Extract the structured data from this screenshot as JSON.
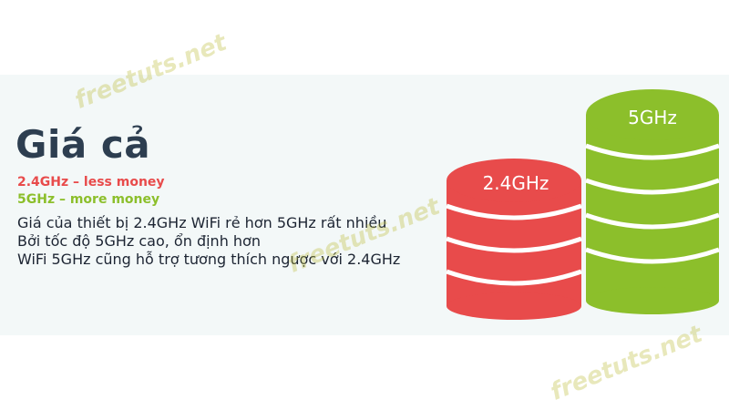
{
  "heading": "Giá cả",
  "subtitles": {
    "low": "2.4GHz – less money",
    "high": "5GHz – more money"
  },
  "body_lines": [
    "Giá của thiết bị 2.4GHz WiFi rẻ hơn 5GHz rất nhiều",
    "Bởi tốc độ 5GHz cao, ổn định hơn",
    "WiFi 5GHz cũng hỗ trợ tương thích ngược với 2.4GHz"
  ],
  "stacks": {
    "left_label": "2.4GHz",
    "right_label": "5GHz"
  },
  "watermark": "freetuts.net",
  "colors": {
    "heading": "#2d3e50",
    "red": "#e84b4b",
    "green": "#8cbf2b"
  }
}
